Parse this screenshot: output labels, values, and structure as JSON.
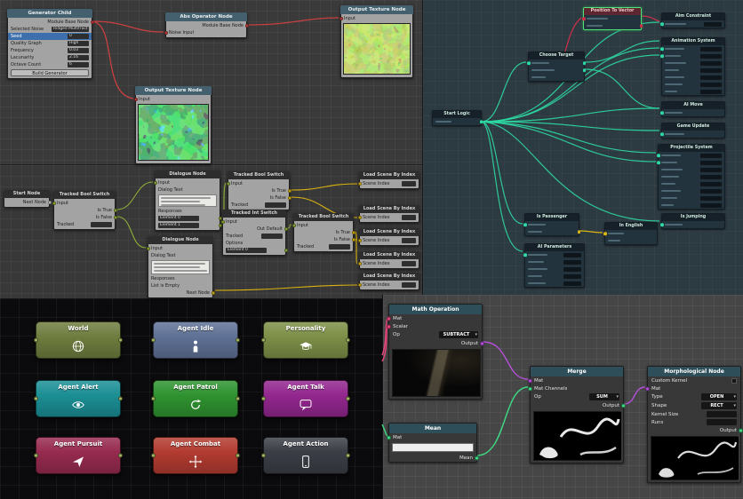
{
  "noise_graph": {
    "generator_child": {
      "title": "Generator Child",
      "output_port": "Module Base Node",
      "rows": [
        {
          "label": "Selected Noise",
          "value": "Ridged Multifract"
        },
        {
          "label": "Seed",
          "value": "0"
        },
        {
          "label": "Quality Graph",
          "value": "High"
        },
        {
          "label": "Frequency",
          "value": "0.03"
        },
        {
          "label": "Lacunarity",
          "value": "2.16"
        },
        {
          "label": "Octave Count",
          "value": "6"
        }
      ],
      "build_button": "Build Generator"
    },
    "abs_operator": {
      "title": "Abs Operator Node",
      "output_port": "Module Base Node",
      "input_port": "Noise Input"
    },
    "output_texture_top": {
      "title": "Output Texture Node",
      "input_port": "Input"
    },
    "output_texture_mid": {
      "title": "Output Texture Node",
      "input_port": "Input"
    },
    "wire_color": "#c84040"
  },
  "dialogue_graph": {
    "start_node": {
      "title": "Start Node",
      "output_port": "Next Node"
    },
    "bool_switch": {
      "title": "Tracked Bool Switch",
      "input_port": "Input",
      "true_port": "Is True",
      "false_port": "Is False",
      "tracked_label": "Tracked"
    },
    "int_switch": {
      "title": "Tracked Int Switch",
      "input_port": "Input",
      "default_port": "Out Default",
      "tracked_label": "Tracked",
      "options_label": "Options",
      "element_0": "Element 0"
    },
    "dialogue_node": {
      "title": "Dialogue Node",
      "input_port": "Input",
      "dialog_text_label": "Dialog Text",
      "responses_label": "Responses",
      "element_0": "Element 0",
      "element_1": "Element 1",
      "empty_list_text": "List is Empty",
      "next_port": "Next Node"
    },
    "load_scene_node": {
      "title": "Load Scene By Index",
      "scene_index_label": "Scene Index"
    },
    "start_wire_color": "#cccccc",
    "flow_wire_color": "#8fae36",
    "scene_wire_color": "#d9b310"
  },
  "logic_graph": {
    "nodes": {
      "start_logic": "Start Logic",
      "choose_target": "Choose Target",
      "position_to_vector": "Position To Vector",
      "aim_constraint": "Aim Constraint",
      "animation_system": "Animation System",
      "ai_move": "AI Move",
      "game_update": "Game Update",
      "projectile_system": "Projectile System",
      "is_jumping": "Is Jumping",
      "is_passenger": "Is Passenger",
      "in_english": "In English",
      "ai_parameters": "AI Parameters"
    },
    "wire_color": "#2ed9a3",
    "target_wire_color": "#cf3049",
    "language_wire_color": "#dcb613",
    "selection_color": "#52e07a"
  },
  "agent_palette": {
    "port_color": "#a4b964",
    "nodes": [
      {
        "label": "World",
        "color": "#6f7d3f",
        "icon": "globe-icon"
      },
      {
        "label": "Agent Idle",
        "color": "#5f7195",
        "icon": "person-icon"
      },
      {
        "label": "Personality",
        "color": "#7d8f47",
        "icon": "graduation-cap-icon"
      },
      {
        "label": "Agent Alert",
        "color": "#1b8f95",
        "icon": "eye-icon"
      },
      {
        "label": "Agent Patrol",
        "color": "#2f9330",
        "icon": "patrol-cycle-icon"
      },
      {
        "label": "Agent Talk",
        "color": "#93278f",
        "icon": "speech-bubble-icon"
      },
      {
        "label": "Agent Pursuit",
        "color": "#972b50",
        "icon": "pursuit-arrow-icon"
      },
      {
        "label": "Agent Combat",
        "color": "#b23b31",
        "icon": "combat-move-icon"
      },
      {
        "label": "Agent Action",
        "color": "#3b3e46",
        "icon": "tablet-icon"
      }
    ]
  },
  "vision_graph": {
    "math_operation": {
      "title": "Math Operation",
      "mat_port": "Mat",
      "scalar_port": "Scalar",
      "op_label": "Op",
      "op_value": "SUBTRACT",
      "output_port": "Output"
    },
    "mean_node": {
      "title": "Mean",
      "mat_port": "Mat",
      "mean_port": "Mean"
    },
    "merge_node": {
      "title": "Merge",
      "mat_port": "Mat",
      "mat_channels_port": "Mat Channels",
      "op_label": "Op",
      "op_value": "SUM",
      "output_port": "Output"
    },
    "morphological_node": {
      "title": "Morphological Node",
      "custom_kernel_label": "Custom Kernel",
      "mat_port": "Mat",
      "type_label": "Type",
      "type_value": "OPEN",
      "shape_label": "Shape",
      "shape_value": "RECT",
      "kernel_size_label": "Kernel Size",
      "runs_label": "Runs",
      "output_port": "Output"
    },
    "mat_wire_color": "#b44fd8",
    "scalar_wire_color": "#e8467c",
    "mean_wire_color": "#3ddc84"
  }
}
